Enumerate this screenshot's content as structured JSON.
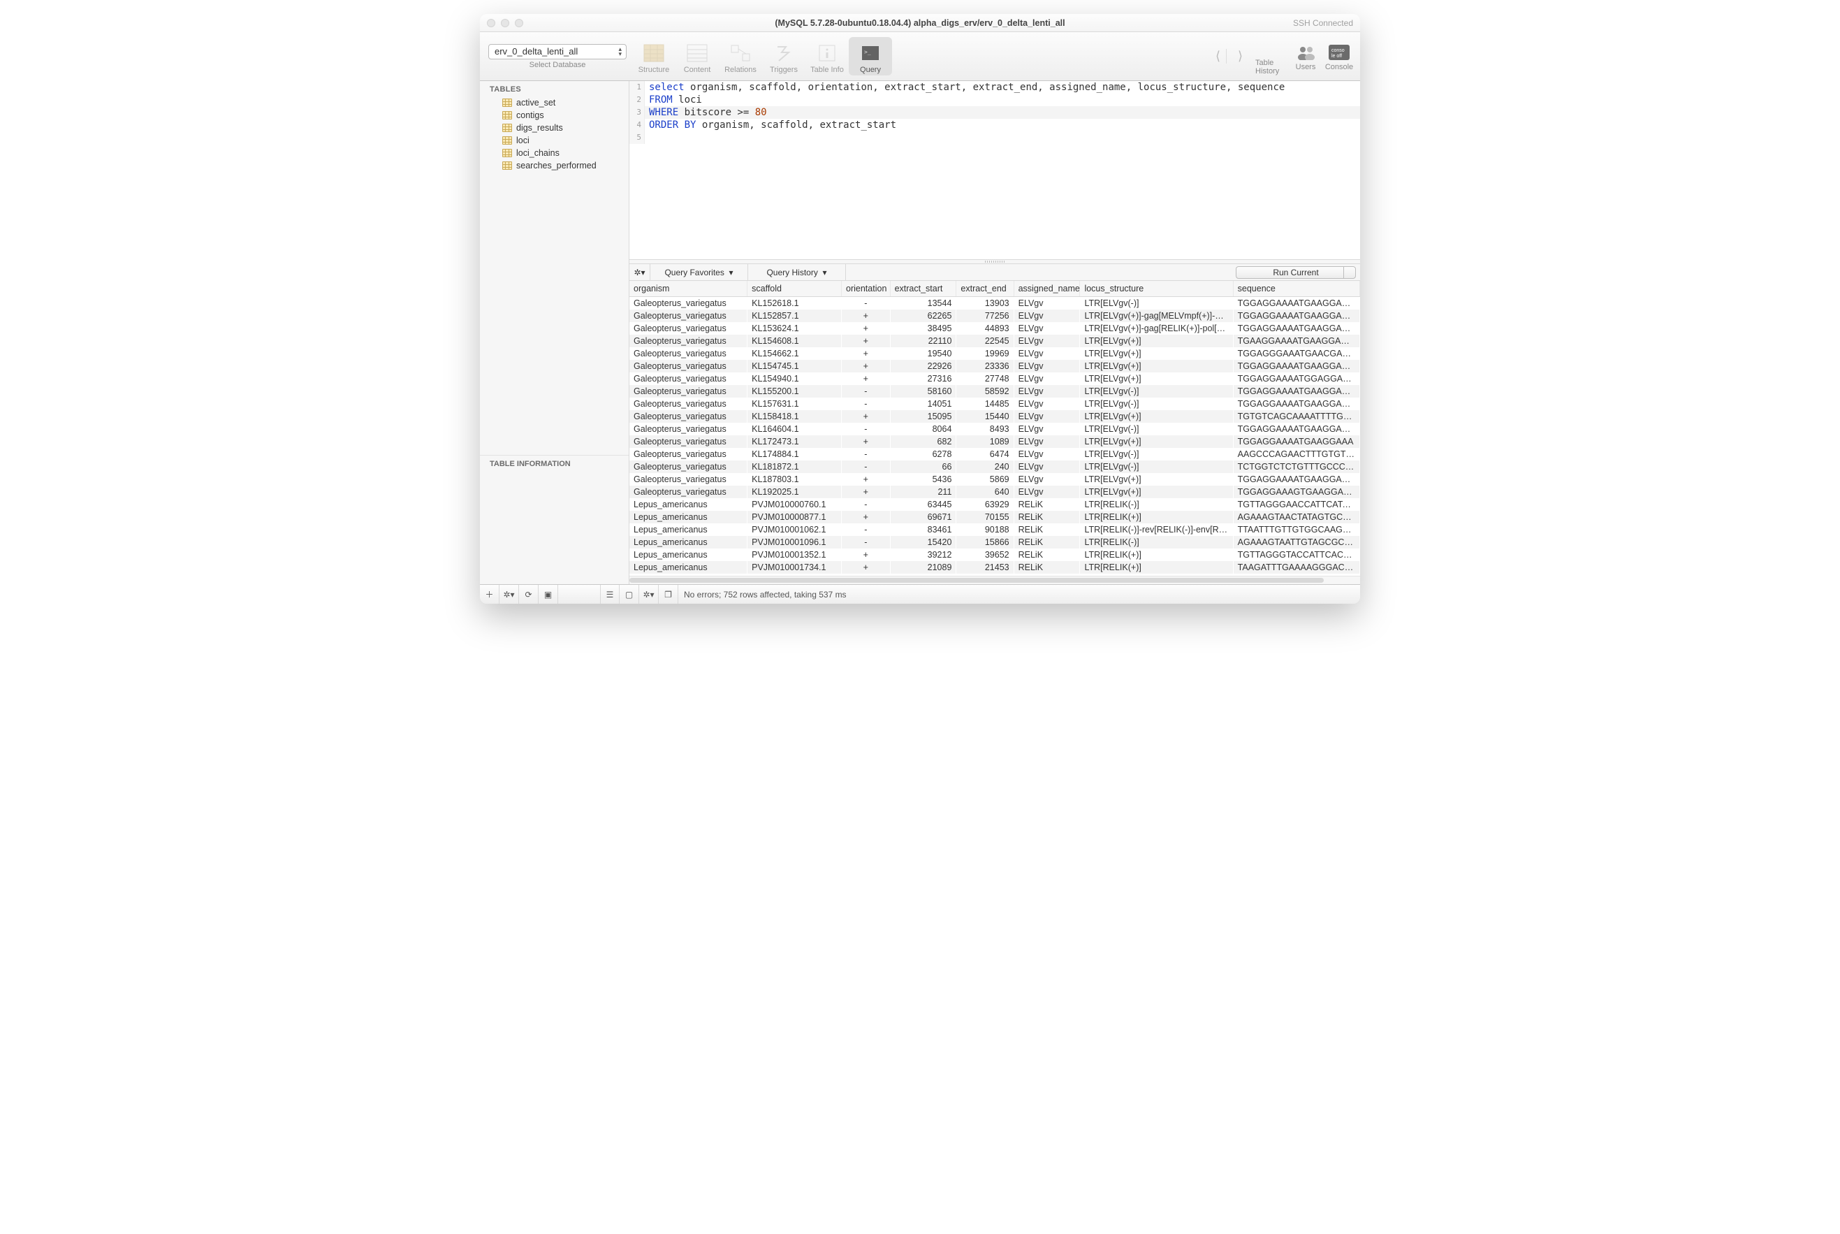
{
  "titlebar": {
    "title": "(MySQL 5.7.28-0ubuntu0.18.04.4) alpha_digs_erv/erv_0_delta_lenti_all",
    "ssh": "SSH Connected"
  },
  "toolbar": {
    "db_selected": "erv_0_delta_lenti_all",
    "db_label": "Select Database",
    "tabs": {
      "structure": "Structure",
      "content": "Content",
      "relations": "Relations",
      "triggers": "Triggers",
      "table_info": "Table Info",
      "query": "Query"
    },
    "right": {
      "table_history": "Table History",
      "users": "Users",
      "console": "Console"
    }
  },
  "sidebar": {
    "header": "TABLES",
    "items": [
      "active_set",
      "contigs",
      "digs_results",
      "loci",
      "loci_chains",
      "searches_performed"
    ],
    "info_header": "TABLE INFORMATION"
  },
  "editor": {
    "lines": [
      {
        "n": "1",
        "tokens": [
          [
            "kw",
            "select"
          ],
          [
            "",
            " organism, scaffold, orientation, extract_start, extract_end, assigned_name, locus_structure, sequence"
          ]
        ]
      },
      {
        "n": "2",
        "tokens": [
          [
            "kw",
            "FROM"
          ],
          [
            "",
            " loci"
          ]
        ]
      },
      {
        "n": "3",
        "tokens": [
          [
            "kw",
            "WHERE"
          ],
          [
            "",
            " bitscore >= "
          ],
          [
            "num",
            "80"
          ]
        ],
        "hl": true
      },
      {
        "n": "4",
        "tokens": [
          [
            "kw",
            "ORDER BY"
          ],
          [
            "",
            " organism, scaffold, extract_start"
          ]
        ]
      },
      {
        "n": "5",
        "tokens": [
          [
            "",
            ""
          ]
        ]
      }
    ]
  },
  "querybar": {
    "favorites": "Query Favorites",
    "history": "Query History",
    "run": "Run Current"
  },
  "results": {
    "columns": [
      "organism",
      "scaffold",
      "orientation",
      "extract_start",
      "extract_end",
      "assigned_name",
      "locus_structure",
      "sequence"
    ],
    "rows": [
      [
        "Galeopterus_variegatus",
        "KL152618.1",
        "-",
        "13544",
        "13903",
        "ELVgv",
        "LTR[ELVgv(-)]",
        "TGGAGGAAAATGAAGGAGAA"
      ],
      [
        "Galeopterus_variegatus",
        "KL152857.1",
        "+",
        "62265",
        "77256",
        "ELVgv",
        "LTR[ELVgv(+)]-gag[MELVmpf(+)]-…",
        "TGGAGGAAAATGAAGGAGAA"
      ],
      [
        "Galeopterus_variegatus",
        "KL153624.1",
        "+",
        "38495",
        "44893",
        "ELVgv",
        "LTR[ELVgv(+)]-gag[RELIK(+)]-pol[…",
        "TGGAGGAAAATGAAGGAGAG"
      ],
      [
        "Galeopterus_variegatus",
        "KL154608.1",
        "+",
        "22110",
        "22545",
        "ELVgv",
        "LTR[ELVgv(+)]",
        "TGAAGGAAAATGAAGGAGAA"
      ],
      [
        "Galeopterus_variegatus",
        "KL154662.1",
        "+",
        "19540",
        "19969",
        "ELVgv",
        "LTR[ELVgv(+)]",
        "TGGAGGGAAATGAACGAGAA"
      ],
      [
        "Galeopterus_variegatus",
        "KL154745.1",
        "+",
        "22926",
        "23336",
        "ELVgv",
        "LTR[ELVgv(+)]",
        "TGGAGGAAAATGAAGGAGAG"
      ],
      [
        "Galeopterus_variegatus",
        "KL154940.1",
        "+",
        "27316",
        "27748",
        "ELVgv",
        "LTR[ELVgv(+)]",
        "TGGAGGAAAATGGAGGAGAA"
      ],
      [
        "Galeopterus_variegatus",
        "KL155200.1",
        "-",
        "58160",
        "58592",
        "ELVgv",
        "LTR[ELVgv(-)]",
        "TGGAGGAAAATGAAGGAGAA"
      ],
      [
        "Galeopterus_variegatus",
        "KL157631.1",
        "-",
        "14051",
        "14485",
        "ELVgv",
        "LTR[ELVgv(-)]",
        "TGGAGGAAAATGAAGGAGAA"
      ],
      [
        "Galeopterus_variegatus",
        "KL158418.1",
        "+",
        "15095",
        "15440",
        "ELVgv",
        "LTR[ELVgv(+)]",
        "TGTGTCAGCAAAATTTTGCAA"
      ],
      [
        "Galeopterus_variegatus",
        "KL164604.1",
        "-",
        "8064",
        "8493",
        "ELVgv",
        "LTR[ELVgv(-)]",
        "TGGAGGAAAATGAAGGAAAG"
      ],
      [
        "Galeopterus_variegatus",
        "KL172473.1",
        "+",
        "682",
        "1089",
        "ELVgv",
        "LTR[ELVgv(+)]",
        "TGGAGGAAAATGAAGGAAA"
      ],
      [
        "Galeopterus_variegatus",
        "KL174884.1",
        "-",
        "6278",
        "6474",
        "ELVgv",
        "LTR[ELVgv(-)]",
        "AAGCCCAGAACTTTGTGTCT"
      ],
      [
        "Galeopterus_variegatus",
        "KL181872.1",
        "-",
        "66",
        "240",
        "ELVgv",
        "LTR[ELVgv(-)]",
        "TCTGGTCTCTGTTTGCCCACC"
      ],
      [
        "Galeopterus_variegatus",
        "KL187803.1",
        "+",
        "5436",
        "5869",
        "ELVgv",
        "LTR[ELVgv(+)]",
        "TGGAGGAAAATGAAGGAGAA"
      ],
      [
        "Galeopterus_variegatus",
        "KL192025.1",
        "+",
        "211",
        "640",
        "ELVgv",
        "LTR[ELVgv(+)]",
        "TGGAGGAAAGTGAAGGAGAA"
      ],
      [
        "Lepus_americanus",
        "PVJM010000760.1",
        "-",
        "63445",
        "63929",
        "RELiK",
        "LTR[RELIK(-)]",
        "TGTTAGGGAACCATTCATAGA"
      ],
      [
        "Lepus_americanus",
        "PVJM010000877.1",
        "+",
        "69671",
        "70155",
        "RELiK",
        "LTR[RELIK(+)]",
        "AGAAAGTAACTATAGTGCCAT"
      ],
      [
        "Lepus_americanus",
        "PVJM010001062.1",
        "-",
        "83461",
        "90188",
        "RELiK",
        "LTR[RELIK(-)]-rev[RELIK(-)]-env[RE…",
        "TTAATTTGTTGTGGCAAGGGA"
      ],
      [
        "Lepus_americanus",
        "PVJM010001096.1",
        "-",
        "15420",
        "15866",
        "RELiK",
        "LTR[RELIK(-)]",
        "AGAAAGTAATTGTAGCGCCGT"
      ],
      [
        "Lepus_americanus",
        "PVJM010001352.1",
        "+",
        "39212",
        "39652",
        "RELiK",
        "LTR[RELIK(+)]",
        "TGTTAGGGTACCATTCACGGA"
      ],
      [
        "Lepus_americanus",
        "PVJM010001734.1",
        "+",
        "21089",
        "21453",
        "RELiK",
        "LTR[RELIK(+)]",
        "TAAGATTTGAAAAGGGACGG"
      ]
    ]
  },
  "status": {
    "msg": "No errors; 752 rows affected, taking 537 ms"
  }
}
